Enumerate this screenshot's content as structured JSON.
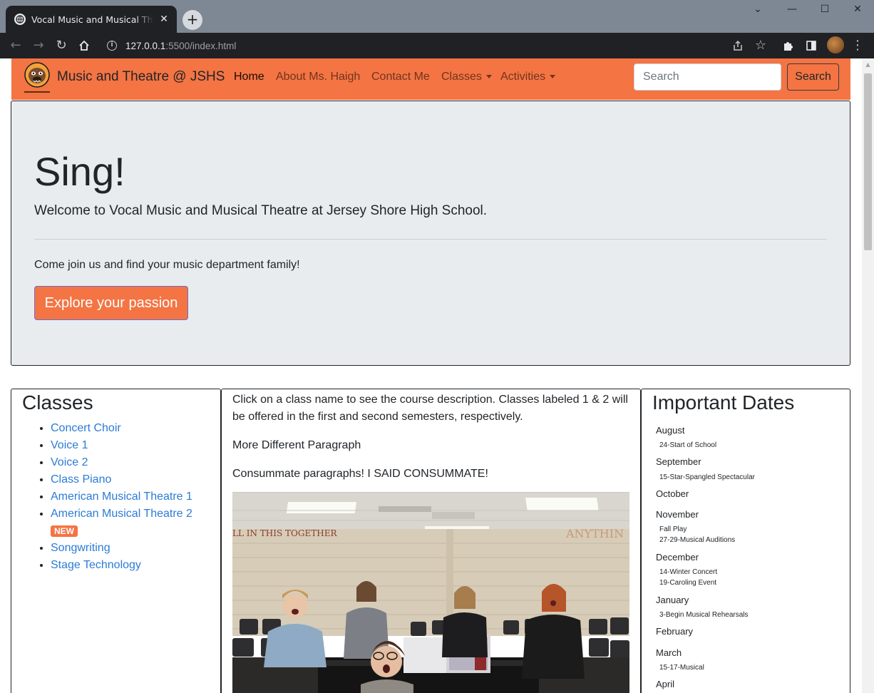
{
  "browser": {
    "tab_title": "Vocal Music and Musical Theatre",
    "url_host": "127.0.0.1",
    "url_rest": ":5500/index.html"
  },
  "navbar": {
    "brand": "Music and Theatre @ JSHS",
    "links": [
      {
        "label": "Home",
        "active": true
      },
      {
        "label": "About Ms. Haigh"
      },
      {
        "label": "Contact Me"
      },
      {
        "label": "Classes",
        "dropdown": true
      },
      {
        "label": "Activities",
        "dropdown": true
      }
    ],
    "search_placeholder": "Search",
    "search_button": "Search",
    "accent_color": "#f47443"
  },
  "jumbotron": {
    "title": "Sing!",
    "lead": "Welcome to Vocal Music and Musical Theatre at Jersey Shore High School.",
    "text": "Come join us and find your music department family!",
    "button": "Explore your passion"
  },
  "classes": {
    "heading": "Classes",
    "items": [
      {
        "label": "Concert Choir"
      },
      {
        "label": "Voice 1"
      },
      {
        "label": "Voice 2"
      },
      {
        "label": "Class Piano"
      },
      {
        "label": "American Musical Theatre 1"
      },
      {
        "label": "American Musical Theatre 2",
        "badge": "NEW"
      },
      {
        "label": "Songwriting"
      },
      {
        "label": "Stage Technology"
      }
    ]
  },
  "middle": {
    "p1": "Click on a class name to see the course description. Classes labeled 1 & 2 will be offered in the first and second semesters, respectively.",
    "p2": "More Different Paragraph",
    "p3": "Consummate paragraphs! I SAID CONSUMMATE!",
    "photo_wall_text_left": "LL IN THIS TOGETHER",
    "photo_wall_text_right": "ANYTHIN"
  },
  "dates": {
    "heading": "Important Dates",
    "months": [
      {
        "month": "August",
        "events": [
          "24-Start of School"
        ]
      },
      {
        "month": "September",
        "events": [
          "15-Star-Spangled Spectacular"
        ]
      },
      {
        "month": "October",
        "events": []
      },
      {
        "month": "November",
        "events": [
          "Fall Play",
          "27-29-Musical Auditions"
        ]
      },
      {
        "month": "December",
        "events": [
          "14-Winter Concert",
          "19-Caroling Event"
        ]
      },
      {
        "month": "January",
        "events": [
          "3-Begin Musical Rehearsals"
        ]
      },
      {
        "month": "February",
        "events": []
      },
      {
        "month": "March",
        "events": [
          "15-17-Musical"
        ]
      },
      {
        "month": "April",
        "events": []
      }
    ]
  }
}
